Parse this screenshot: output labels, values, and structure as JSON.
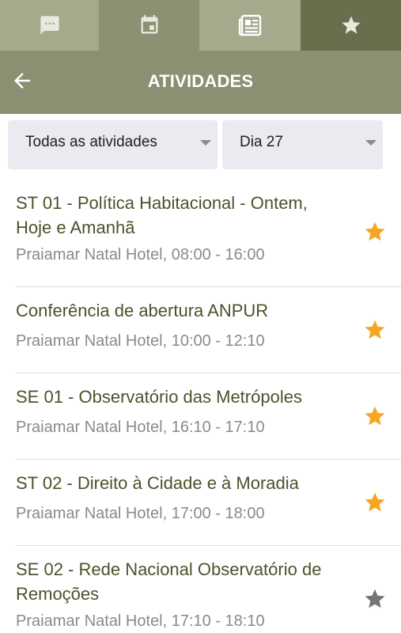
{
  "tabs": [
    {
      "icon": "chat-icon",
      "bg": "#a6a98c",
      "active": false
    },
    {
      "icon": "calendar-icon",
      "bg": "#8d9072",
      "active": false
    },
    {
      "icon": "newspaper-icon",
      "bg": "#a6a98c",
      "active": true
    },
    {
      "icon": "star-icon",
      "bg": "#6b6e4d",
      "active": false
    }
  ],
  "appbar": {
    "title": "ATIVIDADES",
    "back_icon": "arrow-left-icon"
  },
  "filters": {
    "category": "Todas as atividades",
    "day": "Dia 27"
  },
  "activities": [
    {
      "title": "ST 01 - Política Habitacional - Ontem, Hoje e Amanhã",
      "detail": "Praiamar Natal Hotel, 08:00 - 16:00",
      "favorite": true
    },
    {
      "title": "Conferência de abertura ANPUR",
      "detail": "Praiamar Natal Hotel, 10:00 - 12:10",
      "favorite": true
    },
    {
      "title": "SE 01 - Observatório das Metrópoles",
      "detail": "Praiamar Natal Hotel, 16:10 - 17:10",
      "favorite": true
    },
    {
      "title": "ST 02 - Direito à Cidade e à Moradia",
      "detail": "Praiamar Natal Hotel, 17:00 - 18:00",
      "favorite": true
    },
    {
      "title": "SE 02 - Rede Nacional Observatório de Remoções",
      "detail": "Praiamar Natal Hotel, 17:10 - 18:10",
      "favorite": false
    }
  ],
  "colors": {
    "star_on": "#f5a623",
    "star_off": "#757575",
    "title_text": "#50502c",
    "appbar": "#8c8f72"
  }
}
